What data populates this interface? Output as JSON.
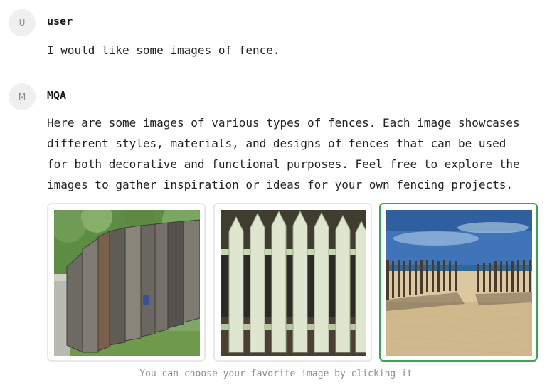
{
  "messages": [
    {
      "avatar": "U",
      "sender": "user",
      "text": "I would like some images of fence."
    },
    {
      "avatar": "M",
      "sender": "MQA",
      "text": "Here are some images of various types of fences. Each image showcases\ndifferent styles, materials, and designs of fences that can be used\nfor both decorative and functional purposes. Feel free to explore the\nimages to gather inspiration or ideas for your own fencing projects."
    }
  ],
  "gallery": {
    "images": [
      {
        "icon": "wooden-fence-image",
        "selected": false
      },
      {
        "icon": "white-picket-fence-image",
        "selected": false
      },
      {
        "icon": "beach-fence-image",
        "selected": true
      }
    ],
    "hint": "You can choose your favorite image by clicking it"
  },
  "colors": {
    "selected_border": "#3aa655",
    "avatar_bg": "#efefef"
  }
}
